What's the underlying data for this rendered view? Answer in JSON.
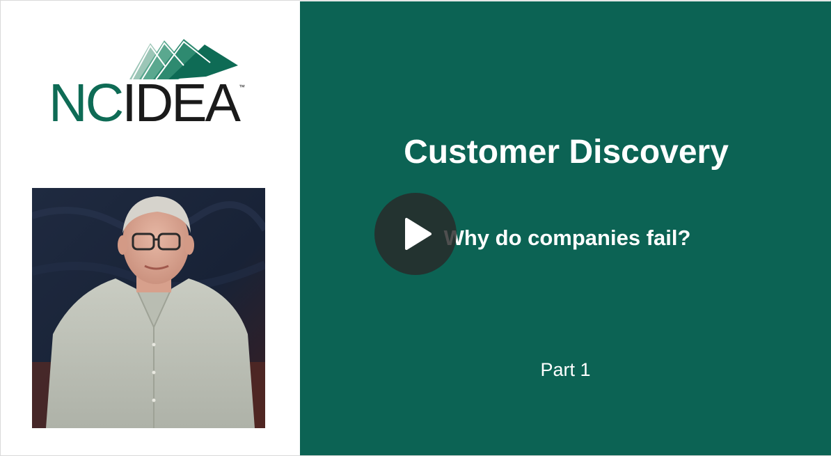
{
  "logo": {
    "prefix": "NC",
    "suffix": "IDEA",
    "trademark": "™",
    "colors": {
      "brand_green": "#0e6b55",
      "mountain_light": "#7fb5a3",
      "mountain_mid": "#3e9a80",
      "mountain_dark": "#0e6b55"
    }
  },
  "presenter": {
    "description_icon": "presenter-video-thumbnail"
  },
  "slide": {
    "title": "Customer Discovery",
    "subtitle": "Why do companies fail?",
    "part": "Part 1",
    "background_color": "#0c6354"
  },
  "player": {
    "play_icon": "play-icon"
  }
}
